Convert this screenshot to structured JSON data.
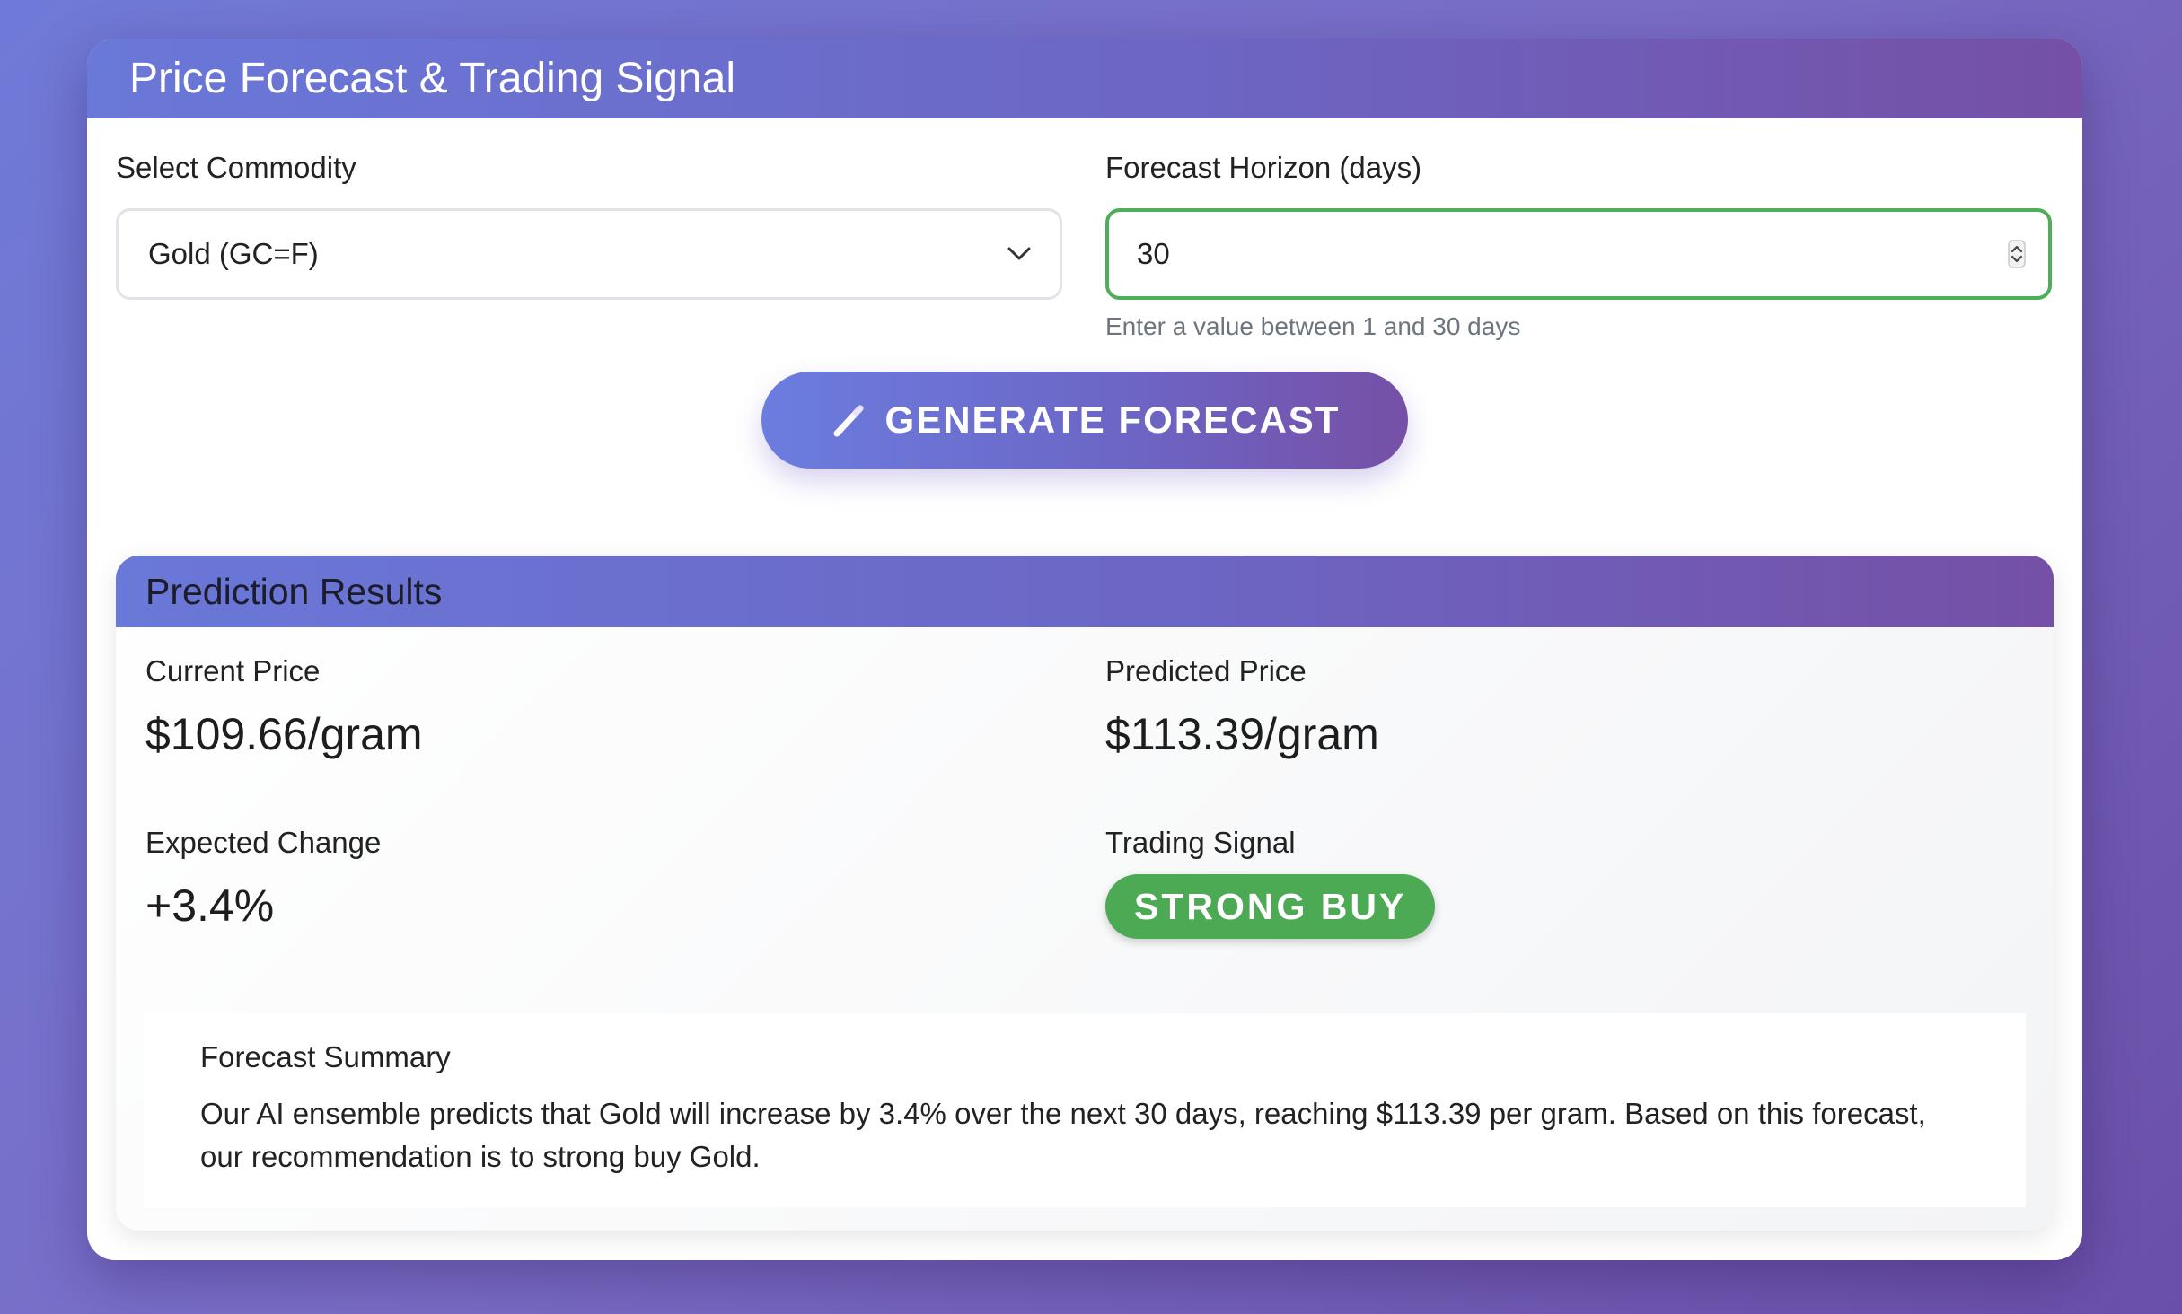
{
  "header": {
    "title": "Price Forecast & Trading Signal"
  },
  "form": {
    "commodity_label": "Select Commodity",
    "commodity_selected": "Gold (GC=F)",
    "horizon_label": "Forecast Horizon (days)",
    "horizon_value": "30",
    "horizon_help": "Enter a value between 1 and 30 days",
    "generate_label": "GENERATE FORECAST"
  },
  "results": {
    "title": "Prediction Results",
    "current_price_label": "Current Price",
    "current_price_value": "$109.66/gram",
    "predicted_price_label": "Predicted Price",
    "predicted_price_value": "$113.39/gram",
    "expected_change_label": "Expected Change",
    "expected_change_value": "+3.4%",
    "trading_signal_label": "Trading Signal",
    "trading_signal_value": "STRONG BUY",
    "summary_title": "Forecast Summary",
    "summary_text": "Our AI ensemble predicts that Gold will increase by 3.4% over the next 30 days, reaching $113.39 per gram. Based on this forecast, our recommendation is to strong buy Gold."
  },
  "icons": {
    "generate": "magic-wand-icon",
    "select": "chevron-down-icon",
    "number": "spinner-arrows-icon"
  },
  "colors": {
    "accent_start": "#6a78d8",
    "accent_end": "#7550a6",
    "signal_green": "#4caa54",
    "focus_border": "#4fae5a"
  }
}
